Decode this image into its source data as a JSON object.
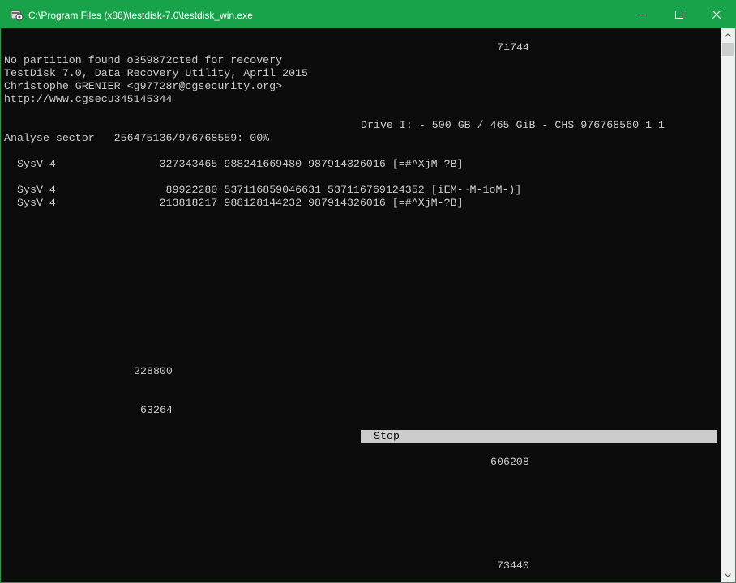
{
  "window": {
    "title": "C:\\Program Files (x86)\\testdisk-7.0\\testdisk_win.exe",
    "controls": {
      "minimize": "minimize-icon",
      "maximize": "maximize-icon",
      "close": "close-icon"
    },
    "titlebar_color": "#18a24a"
  },
  "console": {
    "number_top": "71744",
    "status_line": "No partition found o359872cted for recovery",
    "version_line": "TestDisk 7.0, Data Recovery Utility, April 2015",
    "author_line": "Christophe GRENIER <g97728r@cgsecurity.org>",
    "url_line": "http://www.cgsecu345145344",
    "drive_info": "Drive I: - 500 GB / 465 GiB - CHS 976768560 1 1",
    "analyse_line": "Analyse sector   256475136/976768559: 00%",
    "partitions": [
      "SysV 4                327343465 988241669480 987914326016 [=#^XjM-?B]",
      "SysV 4                 89922280 537116859046631 537116769124352 [iEM-~M-1oM-)]",
      "SysV 4                213818217 988128144232 987914326016 [=#^XjM-?B]"
    ],
    "number_a": "228800",
    "number_b": "63264",
    "stop_label": "Stop",
    "number_c": "606208",
    "number_d": "73440",
    "text_color": "#cccccc",
    "background_color": "#0c0c0c"
  },
  "scrollbar": {
    "up": "scroll-up-arrow-icon",
    "down": "scroll-down-arrow-icon"
  }
}
